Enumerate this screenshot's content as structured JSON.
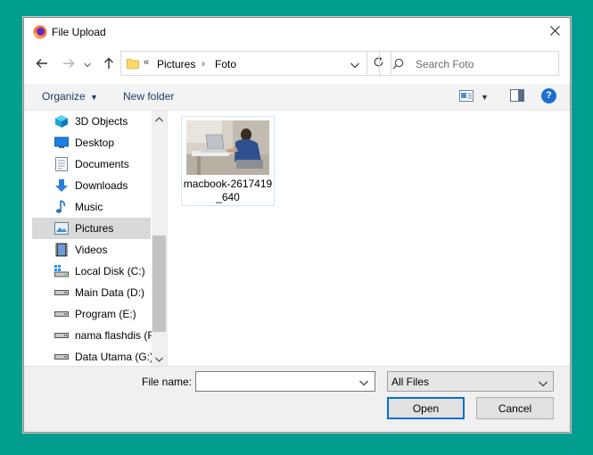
{
  "window": {
    "title": "File Upload"
  },
  "nav": {
    "address": {
      "breadcrumb_prefix": "«",
      "crumbs": [
        "Pictures",
        "Foto"
      ],
      "separator": "›"
    },
    "search": {
      "placeholder": "Search Foto"
    }
  },
  "toolbar": {
    "organize_label": "Organize",
    "new_folder_label": "New folder",
    "help_label": "?"
  },
  "sidebar": {
    "items": [
      {
        "label": "3D Objects",
        "icon": "3d-objects-icon"
      },
      {
        "label": "Desktop",
        "icon": "desktop-icon"
      },
      {
        "label": "Documents",
        "icon": "documents-icon"
      },
      {
        "label": "Downloads",
        "icon": "downloads-icon"
      },
      {
        "label": "Music",
        "icon": "music-icon"
      },
      {
        "label": "Pictures",
        "icon": "pictures-icon",
        "selected": true
      },
      {
        "label": "Videos",
        "icon": "videos-icon"
      },
      {
        "label": "Local Disk (C:)",
        "icon": "system-drive-icon"
      },
      {
        "label": "Main Data (D:)",
        "icon": "drive-icon"
      },
      {
        "label": "Program (E:)",
        "icon": "drive-icon"
      },
      {
        "label": "nama flashdis (F",
        "icon": "drive-icon"
      },
      {
        "label": "Data Utama (G:)",
        "icon": "drive-icon"
      }
    ]
  },
  "files": [
    {
      "name": "macbook-2617419_640"
    }
  ],
  "bottom": {
    "file_name_label": "File name:",
    "file_name_value": "",
    "filter_selected": "All Files",
    "open_label": "Open",
    "cancel_label": "Cancel"
  },
  "colors": {
    "desktop": "#009e8e",
    "accent": "#0a6ed1",
    "selection": "#d9d9d9"
  }
}
